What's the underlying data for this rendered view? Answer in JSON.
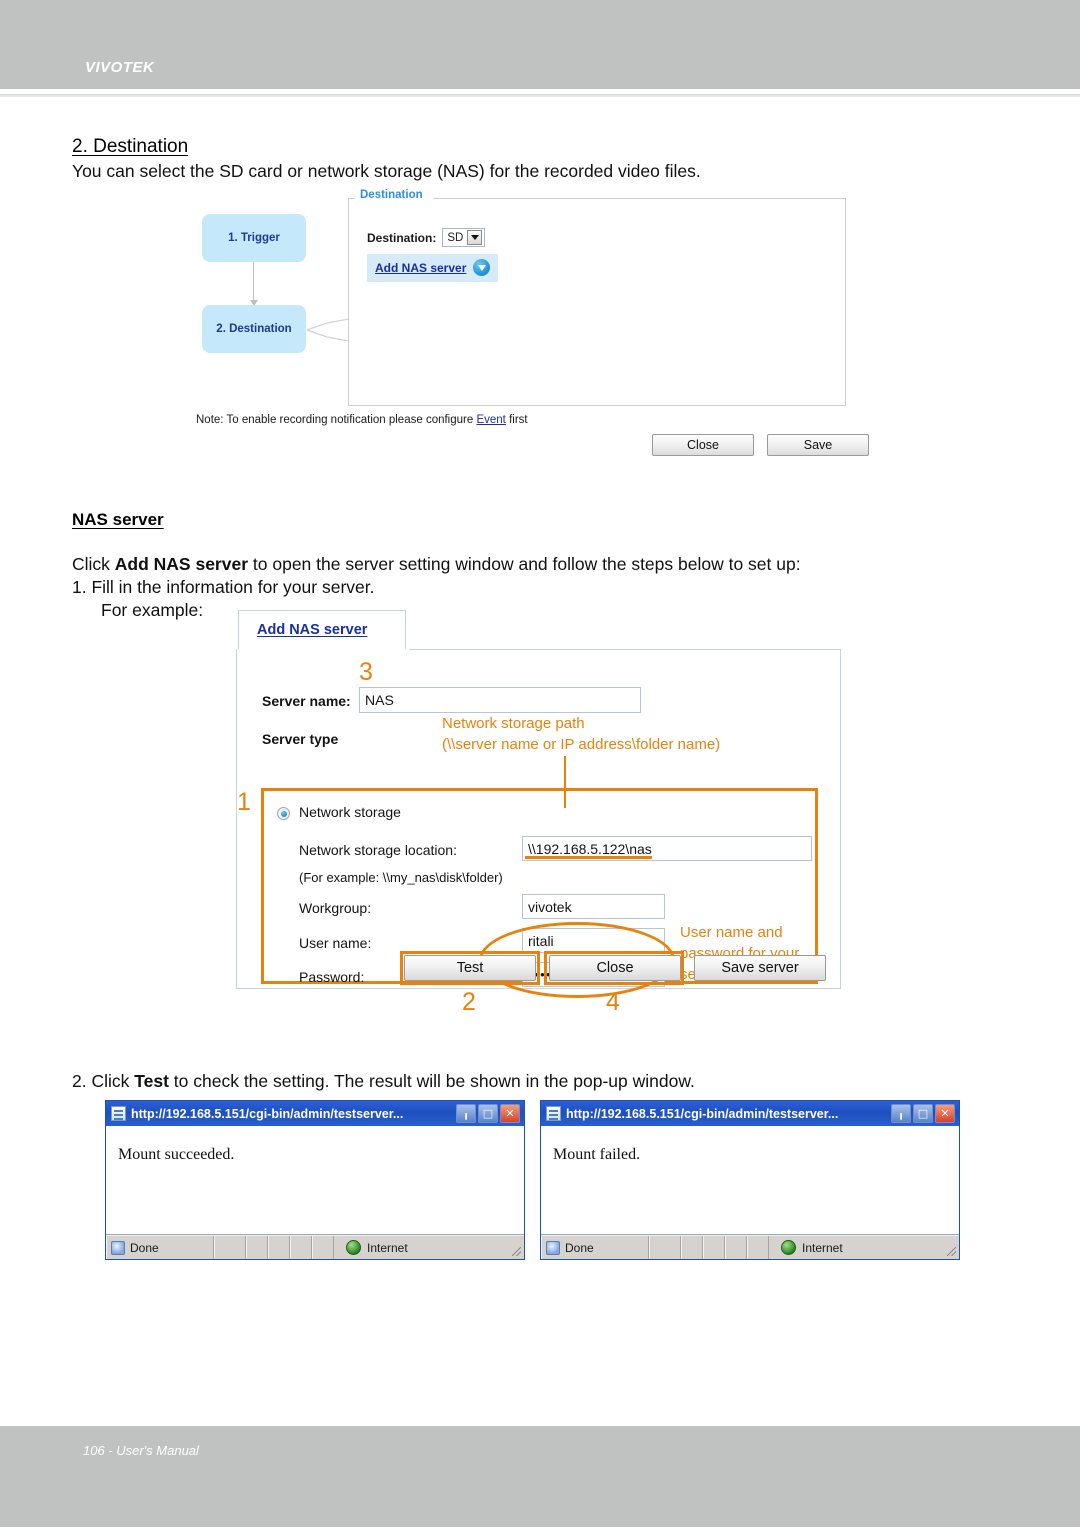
{
  "header": {
    "brand": "VIVOTEK"
  },
  "footer": {
    "text": "106 - User's Manual"
  },
  "doc": {
    "section_heading": "2. Destination",
    "section_intro": "You can select the SD card or network storage (NAS) for the recorded video files.",
    "nas_heading": "NAS server",
    "click_line_pre": "Click ",
    "click_line_bold": "Add NAS server",
    "click_line_post": " to open the server setting window and follow the steps below to set up:",
    "step1": "1. Fill in the information for your server.",
    "step1b": "For example:",
    "step2_pre": "2. Click ",
    "step2_bold": "Test",
    "step2_post": " to check the setting. The result will be shown in the pop-up window."
  },
  "destination_panel": {
    "flow": [
      {
        "label": "1. Trigger"
      },
      {
        "label": "2. Destination"
      }
    ],
    "legend": "Destination",
    "destination_label": "Destination:",
    "destination_value": "SD",
    "destination_options": [
      "SD"
    ],
    "add_nas_button": "Add NAS server",
    "note_pre": "Note: To enable recording notification please configure ",
    "note_link": "Event",
    "note_post": " first",
    "buttons": [
      {
        "label": "Close"
      },
      {
        "label": "Save"
      }
    ]
  },
  "nas_dialog": {
    "tab_label": "Add NAS server",
    "server_name_label": "Server name:",
    "server_name_value": "NAS",
    "server_type_label": "Server type",
    "network_storage_radio": "Network storage",
    "network_storage_selected": true,
    "location_label": "Network storage location:",
    "location_value": "\\\\192.168.5.122\\nas",
    "location_example": "(For example: \\\\my_nas\\disk\\folder)",
    "workgroup_label": "Workgroup:",
    "workgroup_value": "vivotek",
    "username_label": "User name:",
    "username_value": "ritali",
    "password_label": "Password:",
    "password_value": "••••••••",
    "buttons": [
      {
        "label": "Test"
      },
      {
        "label": "Close"
      },
      {
        "label": "Save server"
      }
    ],
    "annotations": {
      "num_1": "1",
      "num_2": "2",
      "num_3": "3",
      "num_4": "4",
      "path_note_line1": "Network storage path",
      "path_note_line2": "(\\\\server name or IP address\\folder name)",
      "cred_note_line1": "User name and",
      "cred_note_line2": "password for your",
      "cred_note_line3": "server",
      "accent_color": "#e8820c"
    }
  },
  "popups": [
    {
      "url": "http://192.168.5.151/cgi-bin/admin/testserver...",
      "message": "Mount succeeded.",
      "status": "Done",
      "zone": "Internet",
      "controls": [
        "minimize",
        "maximize",
        "close"
      ]
    },
    {
      "url": "http://192.168.5.151/cgi-bin/admin/testserver...",
      "message": "Mount failed.",
      "status": "Done",
      "zone": "Internet",
      "controls": [
        "minimize",
        "maximize",
        "close"
      ]
    }
  ]
}
